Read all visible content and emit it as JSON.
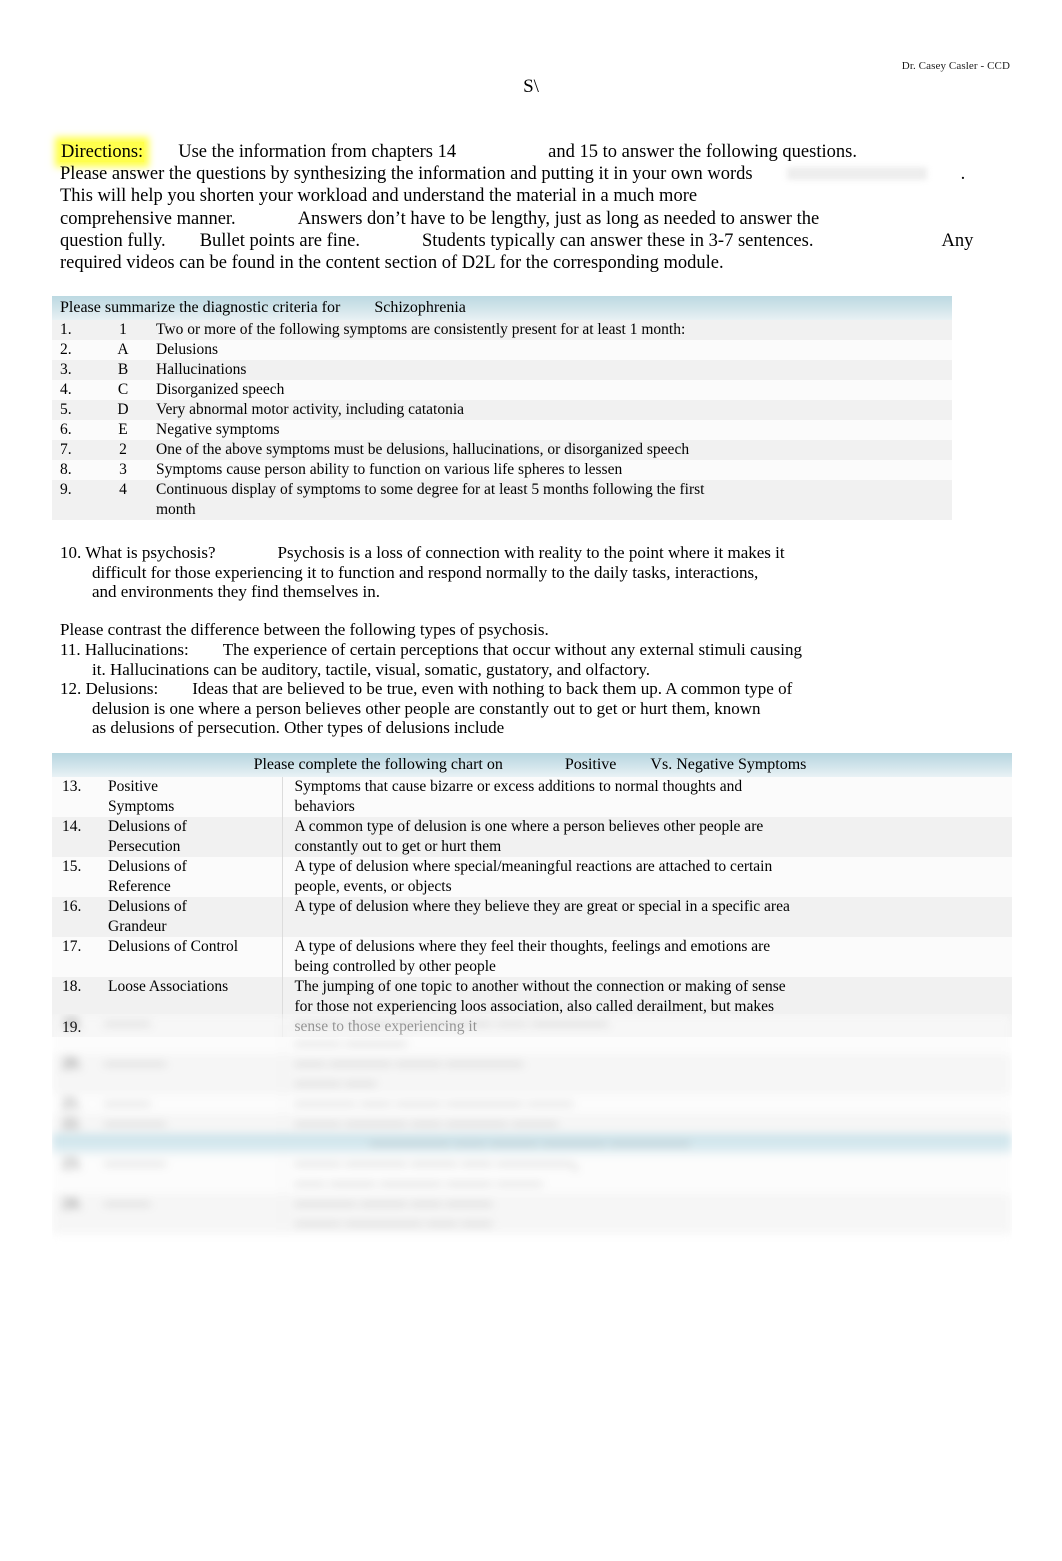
{
  "document": {
    "header_right": "Dr. Casey Casler - CCD",
    "stamp": "S\\"
  },
  "directions": {
    "label": "Directions:",
    "line1_a": "Use the information from chapters 14",
    "line1_b": "and 15 to answer the following questions.",
    "line2_a": "Please answer the questions by synthesizing the information and putting it in your own words",
    "line2_b": ".",
    "line3": "This will help you shorten your workload and understand the material in a much more",
    "line4_a": "comprehensive manner.",
    "line4_b": "Answers don’t have to be lengthy, just as long as needed to answer the",
    "line5_a": "question fully.",
    "line5_b": "Bullet points are fine.",
    "line5_c": "Students typically can answer these in 3-7 sentences.",
    "line5_d": "Any",
    "line6": "required videos can be found in the content section of D2L for the corresponding module."
  },
  "table_criteria": {
    "header_a": "Please summarize the diagnostic criteria for",
    "header_b": "Schizophrenia",
    "rows": [
      {
        "num": "1.",
        "sub": "1",
        "text": "Two or more of the following symptoms are consistently present for at least 1 month:"
      },
      {
        "num": "2.",
        "sub": "A",
        "text": "Delusions"
      },
      {
        "num": "3.",
        "sub": "B",
        "text": "Hallucinations"
      },
      {
        "num": "4.",
        "sub": "C",
        "text": "Disorganized speech"
      },
      {
        "num": "5.",
        "sub": "D",
        "text": "Very abnormal motor activity, including catatonia"
      },
      {
        "num": "6.",
        "sub": "E",
        "text": "Negative symptoms"
      },
      {
        "num": "7.",
        "sub": "2",
        "text": "One of the above symptoms must be delusions, hallucinations, or disorganized speech"
      },
      {
        "num": "8.",
        "sub": "3",
        "text": "Symptoms cause person ability to function on various life spheres to lessen"
      },
      {
        "num": "9.",
        "sub": "4",
        "text": "Continuous display of symptoms to some degree for at least 5 months following the first"
      },
      {
        "num": "",
        "sub": "",
        "text": "month"
      }
    ]
  },
  "prose": {
    "q10_number": "10.",
    "q10_question": "What is psychosis?",
    "q10_answer_line1": "Psychosis is a loss of connection with reality to the point where it makes it",
    "q10_answer_line2": "difficult for those experiencing it to function and respond normally to the daily tasks, interactions,",
    "q10_answer_line3": "and environments they find themselves in.",
    "contrast_instruction": "Please contrast the difference between the following types of psychosis.",
    "q11_number": "11.",
    "q11_term": "Hallucinations:",
    "q11_line1": "The experience of certain perceptions that occur without any external stimuli causing",
    "q11_line2": "it. Hallucinations can be auditory, tactile, visual, somatic, gustatory, and olfactory.",
    "q12_number": "12.",
    "q12_term": "Delusions:",
    "q12_line1": "Ideas that are believed to be true, even with nothing to back them up. A common type of",
    "q12_line2": "delusion is one where a person believes other people are constantly out to get or hurt them, known",
    "q12_line3": "as delusions of persecution. Other types of delusions include"
  },
  "table_symptoms": {
    "header_a": "Please complete the following chart on",
    "header_b": "Positive",
    "header_c": "Vs.",
    "header_d": "Negative Symptoms",
    "rows": [
      {
        "num": "13.",
        "term_line1": "Positive",
        "term_line2": "Symptoms",
        "def_line1": "Symptoms that cause bizarre or excess additions to normal thoughts and",
        "def_line2": "behaviors",
        "def_line3": ""
      },
      {
        "num": "14.",
        "term_line1": "Delusions of",
        "term_line2": "Persecution",
        "def_line1": "A common type of delusion is one where a person believes other people are",
        "def_line2": "constantly out to get or hurt them",
        "def_line3": ""
      },
      {
        "num": "15.",
        "term_line1": "Delusions of",
        "term_line2": "Reference",
        "def_line1": "A type of delusion where special/meaningful reactions are attached to certain",
        "def_line2": "people, events, or objects",
        "def_line3": ""
      },
      {
        "num": "16.",
        "term_line1": "Delusions of",
        "term_line2": "Grandeur",
        "def_line1": "A type of delusion where they believe they are great or special in a specific area",
        "def_line2": "",
        "def_line3": ""
      },
      {
        "num": "17.",
        "term_line1": "Delusions of Control",
        "term_line2": "",
        "def_line1": "A type of delusions where they feel their thoughts, feelings and emotions are",
        "def_line2": "being controlled by other people",
        "def_line3": ""
      },
      {
        "num": "18.",
        "term_line1": "Loose Associations",
        "term_line2": "",
        "def_line1": "The jumping of one topic to another without the connection or making of sense",
        "def_line2": "for those not experiencing loos association, also called derailment, but makes",
        "def_line3": "sense to those experiencing it"
      }
    ]
  },
  "obscured": {
    "visible_number": "19.",
    "note": "remaining content is blurred and illegible",
    "placeholder_rows": [
      {
        "num": "19.",
        "term": "———",
        "def1": "——— ——— —— ———— —— —————",
        "def2": "——— ————"
      },
      {
        "num": "20.",
        "term": "————",
        "def1": "—— ———— ——— —————",
        "def2": "——— ——"
      },
      {
        "num": "21.",
        "term": "———",
        "def1": "———— —— ——— ————— ———",
        "def2": ""
      },
      {
        "num": "22.",
        "term": "————",
        "def1": "——— ———— —— ———— ———",
        "def2": ""
      }
    ],
    "band_header": "————— —— ——— ———— —————",
    "placeholder_rows2": [
      {
        "num": "23.",
        "term": "————",
        "def1": "——— ———— ——— —— —————,",
        "def2": "—— ——— ———— ——— ———"
      },
      {
        "num": "24.",
        "term": "———",
        "def1": "———— ——— —— ———",
        "def2": "——— ————— —— ——"
      }
    ]
  }
}
